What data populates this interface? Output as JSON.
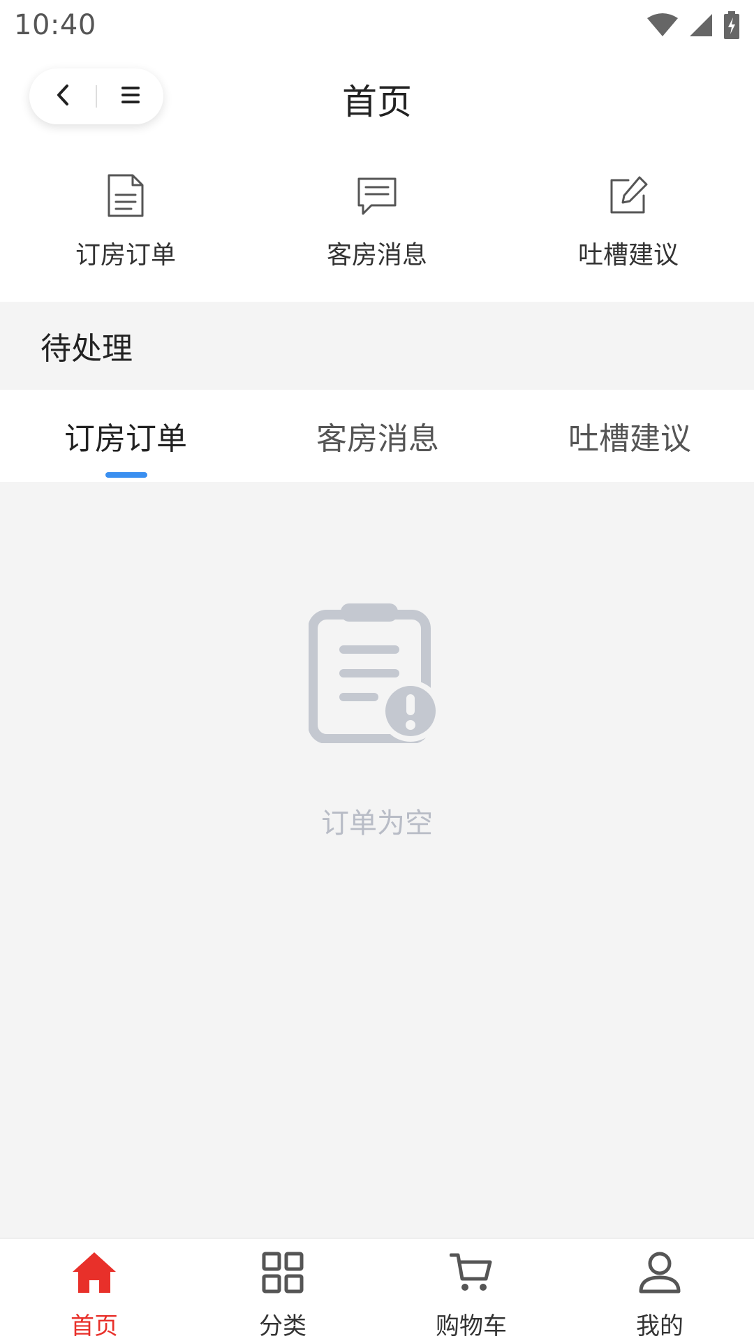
{
  "status_bar": {
    "time": "10:40",
    "icons": [
      "wifi-icon",
      "signal-icon",
      "battery-charging-icon"
    ]
  },
  "nav": {
    "title": "首页",
    "back_icon": "chevron-left-icon",
    "menu_icon": "hamburger-menu-icon"
  },
  "quick_entries": [
    {
      "label": "订房订单",
      "icon": "document-icon"
    },
    {
      "label": "客房消息",
      "icon": "message-icon"
    },
    {
      "label": "吐槽建议",
      "icon": "edit-icon"
    }
  ],
  "section": {
    "title": "待处理"
  },
  "tabs": [
    {
      "label": "订房订单",
      "active": true
    },
    {
      "label": "客房消息",
      "active": false
    },
    {
      "label": "吐槽建议",
      "active": false
    }
  ],
  "empty_state": {
    "icon": "clipboard-alert-icon",
    "text": "订单为空"
  },
  "tabbar": [
    {
      "label": "首页",
      "icon": "home-icon",
      "active": true
    },
    {
      "label": "分类",
      "icon": "grid-icon",
      "active": false
    },
    {
      "label": "购物车",
      "icon": "cart-icon",
      "active": false
    },
    {
      "label": "我的",
      "icon": "user-icon",
      "active": false
    }
  ],
  "colors": {
    "accent_blue": "#3a8ff0",
    "active_red": "#e8302a",
    "empty_gray": "#c4c8d0",
    "background_gray": "#f4f4f4"
  }
}
